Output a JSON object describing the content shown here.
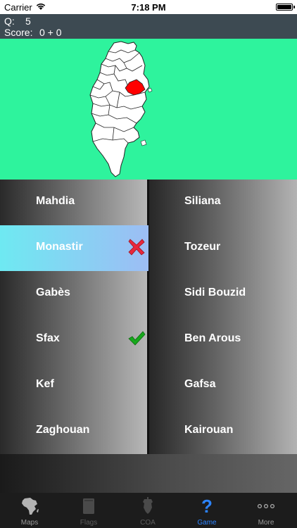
{
  "status_bar": {
    "carrier": "Carrier",
    "time": "7:18 PM"
  },
  "quiz": {
    "question_label": "Q:",
    "question_number": "5",
    "score_label": "Score:",
    "score_value": "0 + 0"
  },
  "map": {
    "background_color": "#2ef39d",
    "highlight_color": "#ff0000"
  },
  "answers": {
    "left": [
      {
        "label": "Mahdia"
      },
      {
        "label": "Monastir",
        "state": "wrong"
      },
      {
        "label": "Gabès"
      },
      {
        "label": "Sfax",
        "state": "correct"
      },
      {
        "label": "Kef"
      },
      {
        "label": "Zaghouan"
      }
    ],
    "right": [
      {
        "label": "Siliana"
      },
      {
        "label": "Tozeur"
      },
      {
        "label": "Sidi Bouzid"
      },
      {
        "label": "Ben Arous"
      },
      {
        "label": "Gafsa"
      },
      {
        "label": "Kairouan"
      }
    ]
  },
  "tabs": [
    {
      "label": "Maps",
      "icon": "africa-map-icon",
      "state": "normal"
    },
    {
      "label": "Flags",
      "icon": "book-icon",
      "state": "disabled"
    },
    {
      "label": "COA",
      "icon": "coat-of-arms-icon",
      "state": "disabled"
    },
    {
      "label": "Game",
      "icon": "question-mark-icon",
      "state": "active"
    },
    {
      "label": "More",
      "icon": "more-dots-icon",
      "state": "normal"
    }
  ],
  "colors": {
    "wrong_bg": "#6ee9f2",
    "tab_active": "#2c84ff",
    "correct_mark": "#17a81c",
    "wrong_mark": "#e8283c"
  }
}
